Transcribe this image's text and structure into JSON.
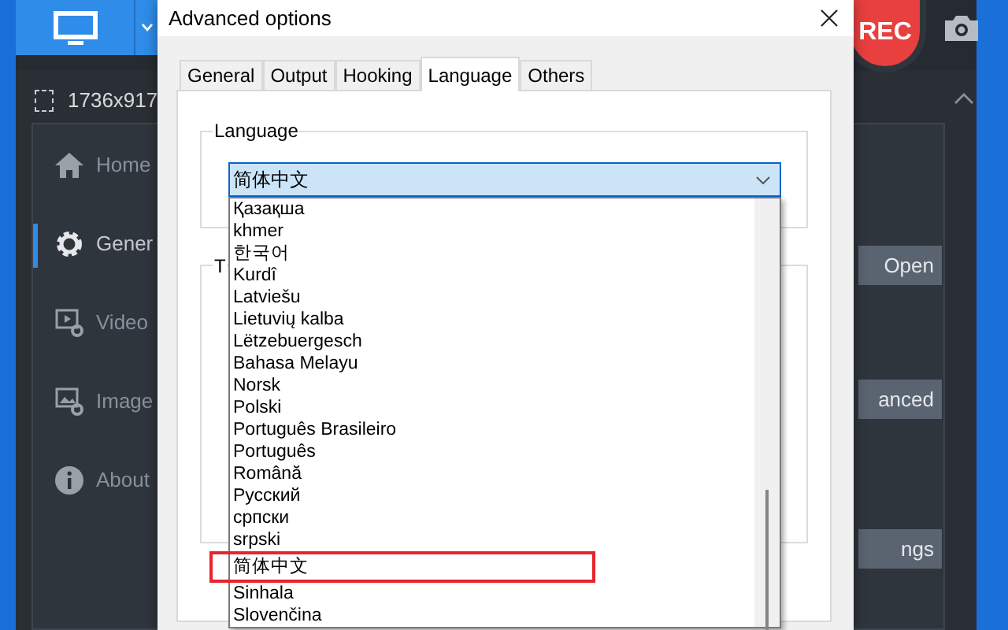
{
  "app": {
    "resolution": "1736x917",
    "nav": [
      {
        "label": "Home",
        "kind": "home",
        "selected": false
      },
      {
        "label": "Gener",
        "kind": "gear",
        "selected": true
      },
      {
        "label": "Video",
        "kind": "video",
        "selected": false
      },
      {
        "label": "Image",
        "kind": "image",
        "selected": false
      },
      {
        "label": "About",
        "kind": "info",
        "selected": false
      }
    ],
    "rec_button": "REC",
    "buttons": [
      "Open",
      "anced",
      "ngs"
    ]
  },
  "dialog": {
    "title": "Advanced options",
    "tabs": [
      {
        "label": "General",
        "selected": false
      },
      {
        "label": "Output",
        "selected": false
      },
      {
        "label": "Hooking",
        "selected": false
      },
      {
        "label": "Language",
        "selected": true
      },
      {
        "label": "Others",
        "selected": false
      }
    ],
    "language_group": {
      "title": "Language",
      "value": "简体中文",
      "options": [
        {
          "label": "Қазақша",
          "highlighted": false
        },
        {
          "label": "khmer",
          "highlighted": false
        },
        {
          "label": "한국어",
          "highlighted": false
        },
        {
          "label": "Kurdî",
          "highlighted": false
        },
        {
          "label": "Latviešu",
          "highlighted": false
        },
        {
          "label": "Lietuvių kalba",
          "highlighted": false
        },
        {
          "label": "Lëtzebuergesch",
          "highlighted": false
        },
        {
          "label": "Bahasa Melayu",
          "highlighted": false
        },
        {
          "label": "Norsk",
          "highlighted": false
        },
        {
          "label": "Polski",
          "highlighted": false
        },
        {
          "label": "Português Brasileiro",
          "highlighted": false
        },
        {
          "label": "Português",
          "highlighted": false
        },
        {
          "label": "Română",
          "highlighted": false
        },
        {
          "label": "Русский",
          "highlighted": false
        },
        {
          "label": "српски",
          "highlighted": false
        },
        {
          "label": "srpski",
          "highlighted": false
        },
        {
          "label": "简体中文",
          "highlighted": true
        },
        {
          "label": "Sinhala",
          "highlighted": false
        },
        {
          "label": "Slovenčina",
          "highlighted": false
        }
      ]
    },
    "second_group": {
      "title": "T"
    }
  }
}
